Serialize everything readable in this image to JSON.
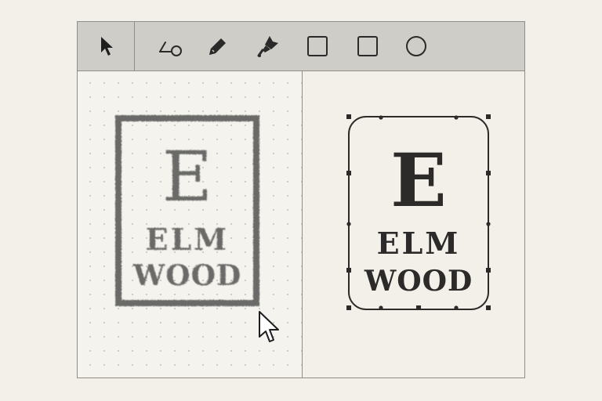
{
  "toolbar": {
    "tools": [
      {
        "id": "select",
        "icon": "arrow-pointer-icon",
        "active": true
      },
      {
        "id": "node",
        "icon": "node-path-icon"
      },
      {
        "id": "pencil",
        "icon": "pencil-icon"
      },
      {
        "id": "pen",
        "icon": "pen-nib-icon"
      },
      {
        "id": "rectangle",
        "icon": "square-icon"
      },
      {
        "id": "rounded-rectangle",
        "icon": "square-icon"
      },
      {
        "id": "ellipse",
        "icon": "circle-icon"
      }
    ]
  },
  "left_panel": {
    "logo_letter": "E",
    "logo_line1": "ELM",
    "logo_line2": "WOOD",
    "style": "raster"
  },
  "right_panel": {
    "logo_letter": "E",
    "logo_line1": "ELM",
    "logo_line2": "WOOD",
    "style": "vector",
    "selected": true
  },
  "colors": {
    "ink_raster": "#6b6a67",
    "ink_vector": "#2c2b29",
    "toolbar_bg": "#cfcdc7",
    "canvas_bg": "#f3f0ea"
  }
}
